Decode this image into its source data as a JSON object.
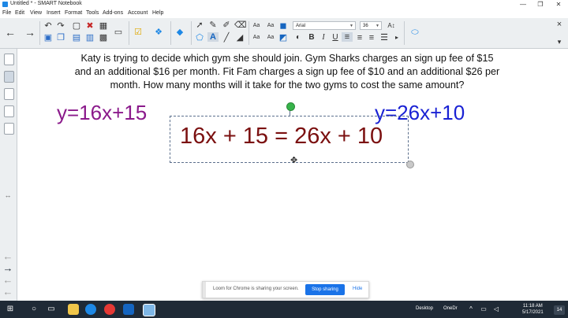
{
  "window": {
    "title": "Untitled * - SMART Notebook",
    "minimize": "—",
    "maximize": "❐",
    "close": "✕"
  },
  "menu": [
    "File",
    "Edit",
    "View",
    "Insert",
    "Format",
    "Tools",
    "Add-ons",
    "Account",
    "Help"
  ],
  "toolbar": {
    "font_name": "Arial",
    "font_size": "36",
    "bold": "B",
    "italic": "I",
    "underline": "U",
    "text_tool": "A",
    "aa_1": "Aa",
    "aa_2": "Aa",
    "aa_3": "Aa",
    "aa_4": "Aa"
  },
  "canvas": {
    "problem_line1": "Katy is trying to decide which gym she should join. Gym Sharks charges an sign up fee of $15",
    "problem_line2": "and an additional $16 per month. Fit Fam charges a sign up fee of $10 and an additional $26 per",
    "problem_line3": "month. How many months will it take for the two gyms to cost the same amount?",
    "equation_left": "y=16x+15",
    "equation_right": "y=26x+10",
    "equation_center": "16x + 15 = 26x + 10",
    "colors": {
      "left": "#8b1a8b",
      "right": "#1a22d4",
      "center": "#7b1010"
    }
  },
  "notification": {
    "message": "Loom for Chrome is sharing your screen.",
    "stop_label": "Stop sharing",
    "hide_label": "Hide"
  },
  "taskbar": {
    "desktop_label": "Desktop",
    "onedrive_label": "OneDr",
    "time": "11:18 AM",
    "date": "5/17/2021",
    "notification_count": "14"
  }
}
